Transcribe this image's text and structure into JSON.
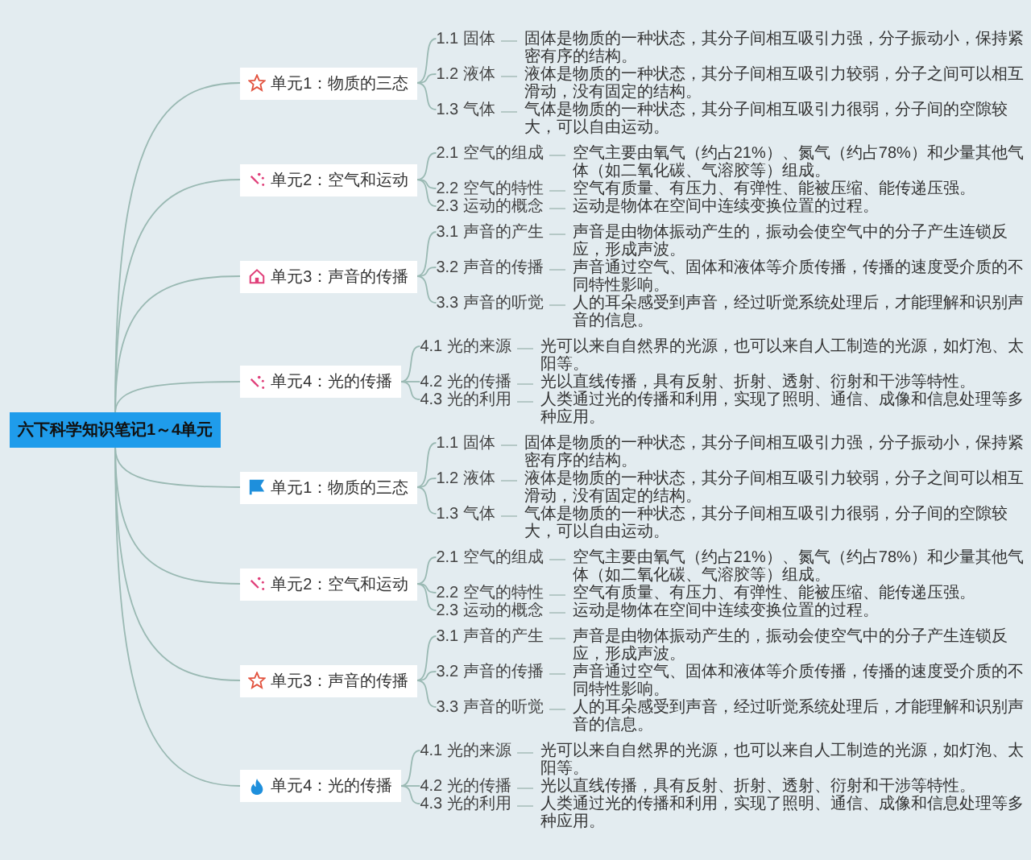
{
  "root": {
    "title": "六下科学知识笔记1～4单元"
  },
  "branches": [
    {
      "title": "单元1：物质的三态",
      "kind": "star",
      "topics": [
        {
          "label": "1.1 固体",
          "note": "固体是物质的一种状态，其分子间相互吸引力强，分子振动小，保持紧密有序的结构。"
        },
        {
          "label": "1.2 液体",
          "note": "液体是物质的一种状态，其分子间相互吸引力较弱，分子之间可以相互滑动，没有固定的结构。"
        },
        {
          "label": "1.3 气体",
          "note": "气体是物质的一种状态，其分子间相互吸引力很弱，分子间的空隙较大，可以自由运动。"
        }
      ]
    },
    {
      "title": "单元2：空气和运动",
      "kind": "wand",
      "topics": [
        {
          "label": "2.1 空气的组成",
          "note": "空气主要由氧气（约占21%）、氮气（约占78%）和少量其他气体（如二氧化碳、气溶胶等）组成。"
        },
        {
          "label": "2.2 空气的特性",
          "note": "空气有质量、有压力、有弹性、能被压缩、能传递压强。"
        },
        {
          "label": "2.3 运动的概念",
          "note": "运动是物体在空间中连续变换位置的过程。"
        }
      ]
    },
    {
      "title": "单元3：声音的传播",
      "kind": "house",
      "topics": [
        {
          "label": "3.1 声音的产生",
          "note": "声音是由物体振动产生的，振动会使空气中的分子产生连锁反应，形成声波。"
        },
        {
          "label": "3.2 声音的传播",
          "note": "声音通过空气、固体和液体等介质传播，传播的速度受介质的不同特性影响。"
        },
        {
          "label": "3.3 声音的听觉",
          "note": "人的耳朵感受到声音，经过听觉系统处理后，才能理解和识别声音的信息。"
        }
      ]
    },
    {
      "title": "单元4：光的传播",
      "kind": "wand",
      "topics": [
        {
          "label": "4.1 光的来源",
          "note": "光可以来自自然界的光源，也可以来自人工制造的光源，如灯泡、太阳等。"
        },
        {
          "label": "4.2 光的传播",
          "note": "光以直线传播，具有反射、折射、透射、衍射和干涉等特性。"
        },
        {
          "label": "4.3 光的利用",
          "note": "人类通过光的传播和利用，实现了照明、通信、成像和信息处理等多种应用。"
        }
      ]
    },
    {
      "title": "单元1：物质的三态",
      "kind": "flag",
      "topics": [
        {
          "label": "1.1 固体",
          "note": "固体是物质的一种状态，其分子间相互吸引力强，分子振动小，保持紧密有序的结构。"
        },
        {
          "label": "1.2 液体",
          "note": "液体是物质的一种状态，其分子间相互吸引力较弱，分子之间可以相互滑动，没有固定的结构。"
        },
        {
          "label": "1.3 气体",
          "note": "气体是物质的一种状态，其分子间相互吸引力很弱，分子间的空隙较大，可以自由运动。"
        }
      ]
    },
    {
      "title": "单元2：空气和运动",
      "kind": "wand",
      "topics": [
        {
          "label": "2.1 空气的组成",
          "note": "空气主要由氧气（约占21%）、氮气（约占78%）和少量其他气体（如二氧化碳、气溶胶等）组成。"
        },
        {
          "label": "2.2 空气的特性",
          "note": "空气有质量、有压力、有弹性、能被压缩、能传递压强。"
        },
        {
          "label": "2.3 运动的概念",
          "note": "运动是物体在空间中连续变换位置的过程。"
        }
      ]
    },
    {
      "title": "单元3：声音的传播",
      "kind": "star",
      "topics": [
        {
          "label": "3.1 声音的产生",
          "note": "声音是由物体振动产生的，振动会使空气中的分子产生连锁反应，形成声波。"
        },
        {
          "label": "3.2 声音的传播",
          "note": "声音通过空气、固体和液体等介质传播，传播的速度受介质的不同特性影响。"
        },
        {
          "label": "3.3 声音的听觉",
          "note": "人的耳朵感受到声音，经过听觉系统处理后，才能理解和识别声音的信息。"
        }
      ]
    },
    {
      "title": "单元4：光的传播",
      "kind": "flame",
      "topics": [
        {
          "label": "4.1 光的来源",
          "note": "光可以来自自然界的光源，也可以来自人工制造的光源，如灯泡、太阳等。"
        },
        {
          "label": "4.2 光的传播",
          "note": "光以直线传播，具有反射、折射、透射、衍射和干涉等特性。"
        },
        {
          "label": "4.3 光的利用",
          "note": "人类通过光的传播和利用，实现了照明、通信、成像和信息处理等多种应用。"
        }
      ]
    }
  ]
}
